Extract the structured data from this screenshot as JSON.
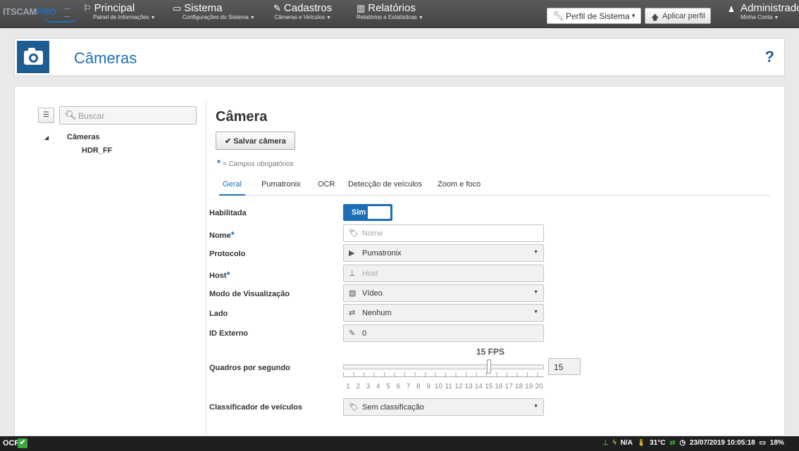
{
  "nav": {
    "logo_a": "ITSCAM",
    "logo_b": "PRO",
    "items": [
      {
        "icon": "flag-icon",
        "title": "Principal",
        "subtitle": "Painel de Informações"
      },
      {
        "icon": "monitor-icon",
        "title": "Sistema",
        "subtitle": "Configurações do Sistema"
      },
      {
        "icon": "edit-icon",
        "title": "Cadastros",
        "subtitle": "Câmeras e Veículos"
      },
      {
        "icon": "bar-chart-icon",
        "title": "Relatórios",
        "subtitle": "Relatórios e Estatísticas"
      }
    ],
    "profile_select": "Perfil de Sistema",
    "apply_profile": "Aplicar perfil",
    "user_title": "Administrador",
    "user_subtitle": "Minha Conta"
  },
  "header": {
    "title": "Câmeras",
    "help": "?"
  },
  "sidebar": {
    "search_placeholder": "Buscar",
    "tree_root": "Câmeras",
    "tree_child": "HDR_FF"
  },
  "form": {
    "title": "Câmera",
    "save_label": "Salvar câmera",
    "required_asterisk": "*",
    "required_note": "= Campos obrigatórios",
    "tabs": [
      "Geral",
      "Pumatronix",
      "OCR",
      "Detecção de veículos",
      "Zoom e foco"
    ],
    "active_tab": "Geral",
    "fields": {
      "habilitada": {
        "label": "Habilitada",
        "value": "Sim",
        "enabled": true
      },
      "nome": {
        "label": "Nome",
        "placeholder": "Nome",
        "value": ""
      },
      "protocolo": {
        "label": "Protocolo",
        "value": "Pumatronix"
      },
      "host": {
        "label": "Host",
        "placeholder": "Host",
        "value": ""
      },
      "modo": {
        "label": "Modo de Visualização",
        "value": "Vídeo"
      },
      "lado": {
        "label": "Lado",
        "value": "Nenhum"
      },
      "id_externo": {
        "label": "ID Externo",
        "value": "0"
      },
      "quadros": {
        "label": "Quadros por segundo",
        "display": "15 FPS",
        "value": "15",
        "min": 1,
        "max": 20,
        "ticks": [
          "1",
          "2",
          "3",
          "4",
          "5",
          "6",
          "7",
          "8",
          "9",
          "10",
          "11",
          "12",
          "13",
          "14",
          "15",
          "16",
          "17",
          "18",
          "19",
          "20"
        ]
      },
      "classificador": {
        "label": "Classificador de veículos",
        "value": "Sem classificação"
      }
    }
  },
  "statusbar": {
    "ocr": "OCR",
    "power": "N/A",
    "temperature": "31°C",
    "datetime": "23/07/2019 10:05:18",
    "disk": "18%"
  },
  "colors": {
    "accent": "#1e6fb8",
    "header_tile": "#1e5d92",
    "nav_bg": "#4a4a4a",
    "status_ok": "#3aa83a"
  }
}
